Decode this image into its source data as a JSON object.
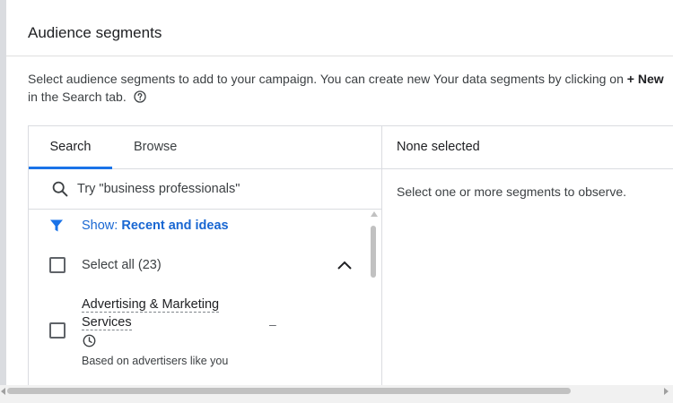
{
  "card": {
    "title": "Audience segments",
    "description_prefix": "Select audience segments to add to your campaign. You can create new Your data segments by clicking on ",
    "description_bold": "+ New",
    "description_line2": "in the Search tab."
  },
  "tabs": [
    {
      "label": "Search",
      "active": true
    },
    {
      "label": "Browse",
      "active": false
    }
  ],
  "search": {
    "placeholder": "Try \"business professionals\"",
    "value": ""
  },
  "filter": {
    "prefix": "Show: ",
    "value": "Recent and ideas"
  },
  "select_all": {
    "label": "Select all (23)",
    "checked": false
  },
  "items": [
    {
      "name": "Advertising & Marketing Services",
      "dash": "–",
      "subtitle": "Based on advertisers like you",
      "checked": false
    }
  ],
  "right_panel": {
    "title": "None selected",
    "empty_message": "Select one or more segments to observe."
  },
  "icons": {
    "help": "help-circle-icon",
    "search": "search-icon",
    "filter": "filter-funnel-icon",
    "chevron": "chevron-up-icon",
    "clock": "clock-icon"
  },
  "colors": {
    "accent": "#1a73e8",
    "link": "#1967d2",
    "border": "#dadce0"
  }
}
